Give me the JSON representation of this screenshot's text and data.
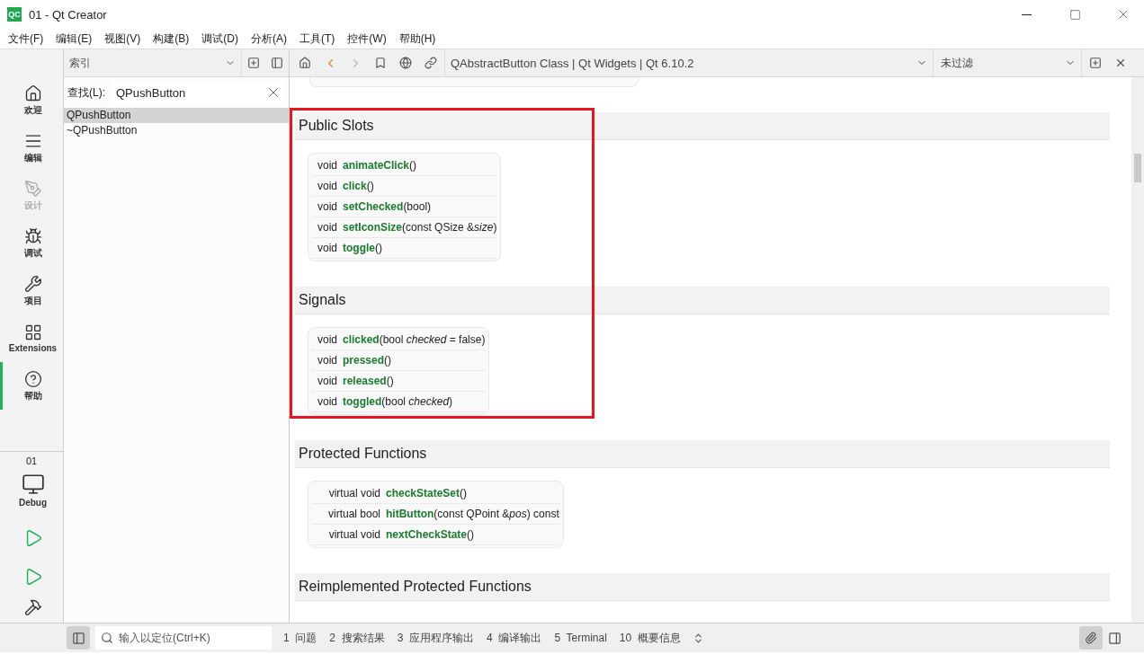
{
  "window": {
    "title": "01 - Qt Creator",
    "logo": "QC"
  },
  "menu": [
    "文件(F)",
    "编辑(E)",
    "视图(V)",
    "构建(B)",
    "调试(D)",
    "分析(A)",
    "工具(T)",
    "控件(W)",
    "帮助(H)"
  ],
  "modes": [
    {
      "label": "欢迎",
      "selected": false,
      "disabled": false
    },
    {
      "label": "编辑",
      "selected": false,
      "disabled": false
    },
    {
      "label": "设计",
      "selected": false,
      "disabled": true
    },
    {
      "label": "调试",
      "selected": false,
      "disabled": false
    },
    {
      "label": "项目",
      "selected": false,
      "disabled": false
    },
    {
      "label": "Extensions",
      "selected": false,
      "disabled": false
    },
    {
      "label": "帮助",
      "selected": true,
      "disabled": false
    }
  ],
  "target": {
    "project": "01",
    "config": "Debug"
  },
  "index_pane": {
    "selector": "索引",
    "search_label": "查找(L):",
    "search_value": "QPushButton",
    "results": [
      {
        "label": "QPushButton",
        "selected": true
      },
      {
        "label": "~QPushButton",
        "selected": false
      }
    ]
  },
  "doc_toolbar": {
    "page": "QAbstractButton Class | Qt Widgets | Qt 6.10.2",
    "filter": "未过滤"
  },
  "highlight_frame": true,
  "sections": [
    {
      "title": "Public Slots",
      "members": [
        {
          "type": "void",
          "name": "animateClick",
          "params": "()"
        },
        {
          "type": "void",
          "name": "click",
          "params": "()"
        },
        {
          "type": "void",
          "name": "setChecked",
          "params": "(bool)"
        },
        {
          "type": "void",
          "name": "setIconSize",
          "params": "(const QSize &*size*)"
        },
        {
          "type": "void",
          "name": "toggle",
          "params": "()"
        }
      ]
    },
    {
      "title": "Signals",
      "members": [
        {
          "type": "void",
          "name": "clicked",
          "params": "(bool *checked* = false)"
        },
        {
          "type": "void",
          "name": "pressed",
          "params": "()"
        },
        {
          "type": "void",
          "name": "released",
          "params": "()"
        },
        {
          "type": "void",
          "name": "toggled",
          "params": "(bool *checked*)"
        }
      ]
    },
    {
      "title": "Protected Functions",
      "members": [
        {
          "type": "virtual void",
          "name": "checkStateSet",
          "params": "()"
        },
        {
          "type": "virtual bool",
          "name": "hitButton",
          "params": "(const QPoint &*pos*) const"
        },
        {
          "type": "virtual void",
          "name": "nextCheckState",
          "params": "()"
        }
      ]
    },
    {
      "title": "Reimplemented Protected Functions"
    }
  ],
  "status_bar": {
    "locator_placeholder": "输入以定位(Ctrl+K)",
    "panes": [
      "1  问题",
      "2  搜索结果",
      "3  应用程序输出",
      "4  编译输出",
      "5  Terminal",
      "10  概要信息"
    ]
  }
}
